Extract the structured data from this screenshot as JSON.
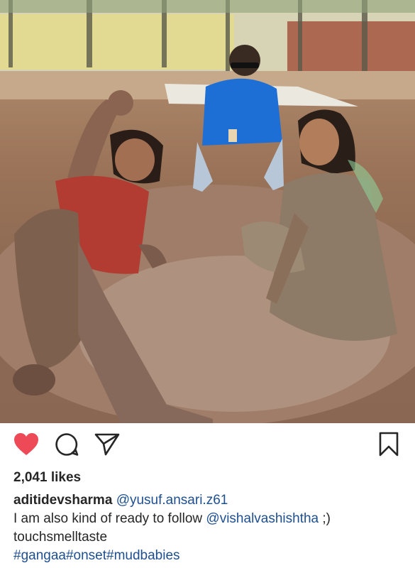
{
  "post": {
    "likes_text": "2,041 likes",
    "username": "aditidevsharma",
    "caption_mention": "@yusuf.ansari.z61",
    "caption_text": "I am also kind of ready to follow",
    "caption_mention_2": "@vishalvashishtha",
    "caption_suffix": ";)",
    "caption_line_3": "touchsmelltaste",
    "hashtags": "#gangaa#onset#mudbabies"
  },
  "actions": {
    "like_icon": "heart-icon",
    "comment_icon": "comment-icon",
    "share_icon": "share-icon",
    "save_icon": "bookmark-icon",
    "like_active": true
  },
  "colors": {
    "liked_heart": "#ed4956",
    "text": "#262626",
    "link": "#1e4f8f"
  }
}
